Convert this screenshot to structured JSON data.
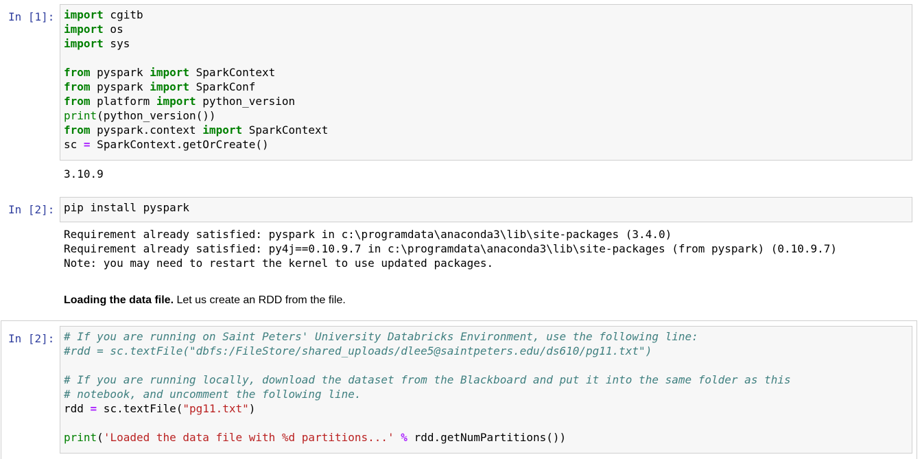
{
  "cells": [
    {
      "prompt": "In [1]:",
      "code": [
        "import cgitb",
        "import os",
        "import sys",
        "",
        "from pyspark import SparkContext",
        "from pyspark import SparkConf",
        "from platform import python_version",
        "print(python_version())",
        "from pyspark.context import SparkContext",
        "sc = SparkContext.getOrCreate()"
      ],
      "output": [
        "3.10.9"
      ]
    },
    {
      "prompt": "In [2]:",
      "code": [
        "pip install pyspark"
      ],
      "output": [
        "Requirement already satisfied: pyspark in c:\\programdata\\anaconda3\\lib\\site-packages (3.4.0)",
        "Requirement already satisfied: py4j==0.10.9.7 in c:\\programdata\\anaconda3\\lib\\site-packages (from pyspark) (0.10.9.7)",
        "Note: you may need to restart the kernel to use updated packages."
      ]
    },
    {
      "prompt": "In [2]:",
      "code": [
        "# If you are running on Saint Peters' University Databricks Environment, use the following line:",
        "#rdd = sc.textFile(\"dbfs:/FileStore/shared_uploads/dlee5@saintpeters.edu/ds610/pg11.txt\")",
        "",
        "# If you are running locally, download the dataset from the Blackboard and put it into the same folder as this",
        "# notebook, and uncomment the following line.",
        "rdd = sc.textFile(\"pg11.txt\")",
        "",
        "print('Loaded the data file with %d partitions...' % rdd.getNumPartitions())"
      ],
      "output": []
    }
  ],
  "markdown": {
    "bold": "Loading the data file.",
    "text": " Let us create an RDD from the file."
  },
  "colors": {
    "prompt": "#303f9f",
    "keyword": "#008000",
    "operator": "#aa22ff",
    "string": "#ba2121",
    "comment": "#408080",
    "cell_background": "#f7f7f7",
    "cell_border": "#cfcfcf"
  }
}
